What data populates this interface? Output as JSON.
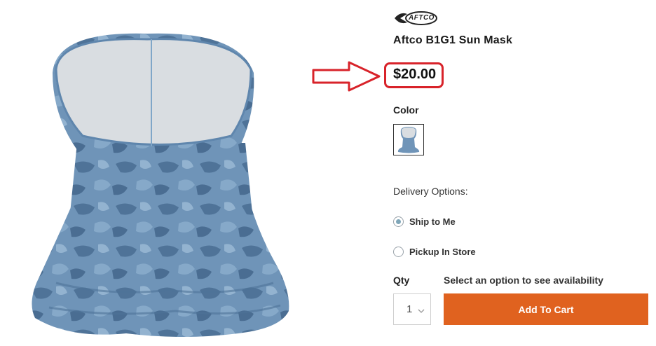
{
  "brand": {
    "logo_text": "AFTCO"
  },
  "product": {
    "title": "Aftco B1G1 Sun Mask",
    "price": "$20.00"
  },
  "color": {
    "label": "Color"
  },
  "delivery": {
    "label": "Delivery Options:",
    "options": [
      {
        "label": "Ship to Me",
        "selected": true
      },
      {
        "label": "Pickup In Store",
        "selected": false
      }
    ]
  },
  "quantity": {
    "label": "Qty",
    "value": "1",
    "availability_text": "Select an option to see availability"
  },
  "cart": {
    "add_label": "Add To Cart"
  },
  "colors": {
    "accent": "#e0621f",
    "annotation": "#d8232a",
    "product_blue": "#5f86ad"
  }
}
